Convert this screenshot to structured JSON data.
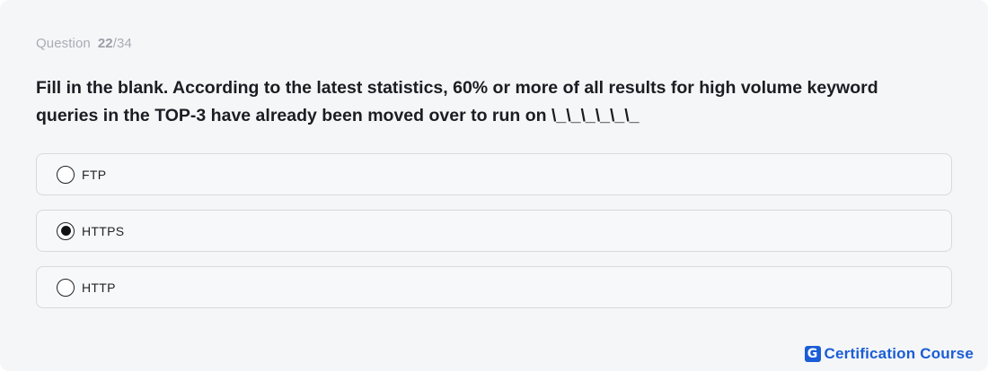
{
  "header": {
    "counter_label": "Question",
    "counter_current": "22",
    "counter_total": "/34"
  },
  "question": {
    "text": "Fill in the blank. According to the latest statistics, 60% or more of all results for high volume keyword queries in the TOP-3 have already been moved over to run on \\_\\_\\_\\_\\_\\_"
  },
  "options": [
    {
      "label": "FTP",
      "selected": false
    },
    {
      "label": "HTTPS",
      "selected": true
    },
    {
      "label": "HTTP",
      "selected": false
    }
  ],
  "brand": {
    "logo_letter": "G",
    "name": "Certification Course",
    "color": "#1a5dd6"
  },
  "icons": {
    "radio_unselected": "radio-empty-icon",
    "radio_selected": "radio-filled-icon"
  }
}
